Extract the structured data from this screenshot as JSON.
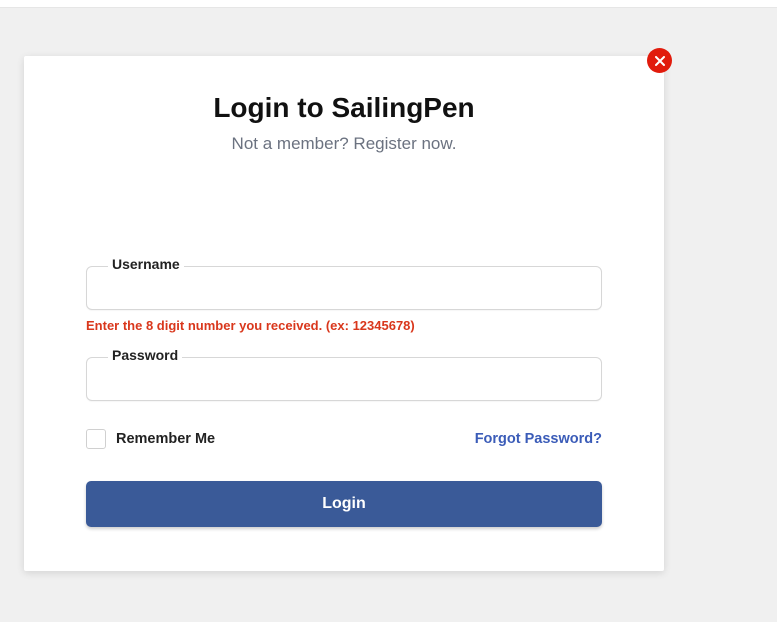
{
  "modal": {
    "title": "Login to SailingPen",
    "subtitle": "Not a member? Register now."
  },
  "form": {
    "username": {
      "label": "Username",
      "value": "",
      "error": "Enter the 8 digit number you received. (ex: 12345678)"
    },
    "password": {
      "label": "Password",
      "value": ""
    },
    "remember": {
      "label": "Remember Me",
      "checked": false
    },
    "forgot": "Forgot Password?",
    "submit": "Login"
  },
  "icons": {
    "close": "close-icon"
  }
}
